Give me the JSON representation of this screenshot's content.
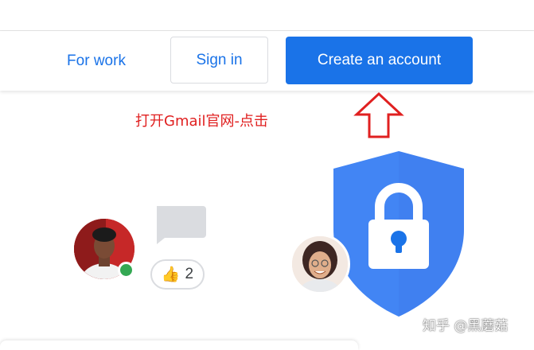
{
  "nav": {
    "for_work_label": "For work",
    "sign_in_label": "Sign in",
    "create_account_label": "Create an account"
  },
  "annotation": {
    "text": "打开Gmail官网-点击",
    "color": "#e02020"
  },
  "reaction": {
    "emoji": "👍",
    "count": "2"
  },
  "watermark": {
    "text": "知乎 @黑蘑菇"
  },
  "colors": {
    "primary_blue": "#1a73e8",
    "shield_blue": "#4285f4",
    "presence_green": "#34a853",
    "annotation_red": "#e02020"
  },
  "icons": {
    "arrow": "up-arrow-outline-icon",
    "chat": "chat-bubble-icon",
    "shield": "shield-lock-icon"
  }
}
